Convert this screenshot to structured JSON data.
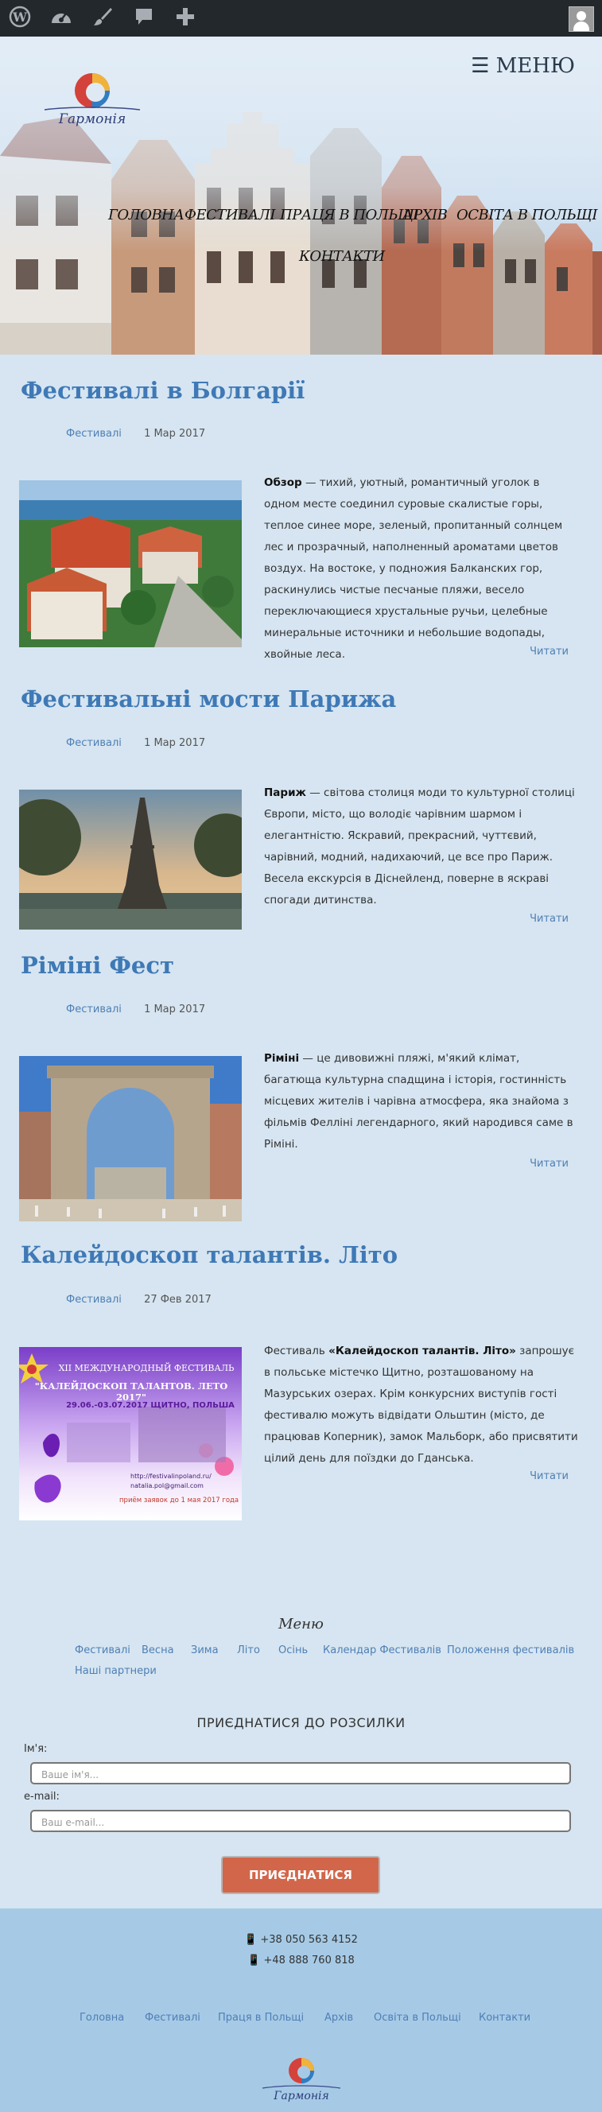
{
  "admin_bar": {
    "icons": [
      "wordpress-icon",
      "dashboard-icon",
      "customize-brush-icon",
      "comments-icon",
      "add-new-icon",
      "user-avatar-icon"
    ]
  },
  "header": {
    "logo_text": "Гармонія",
    "menu_toggle": "☰ МЕНЮ",
    "nav": [
      "ГОЛОВНА",
      "ФЕСТИВАЛІ",
      "ПРАЦЯ В ПОЛЬЩІ",
      "АРХІВ",
      "ОСВІТА В ПОЛЬЩІ",
      "КОНТАКТИ"
    ]
  },
  "posts": [
    {
      "title": "Фестивалі в Болгарії",
      "category": "Фестивалі",
      "date": "1 Мар 2017",
      "lead": "Обзор",
      "excerpt": " — тихий, уютный, романтичный уголок в одном месте соединил суровые скалистые горы, теплое синее море, зеленый, пропитанный солнцем лес и прозрачный, наполненный ароматами цветов воздух. На востоке, у подножия Балканских гор, раскинулись чистые песчаные пляжи, весело переключающиеся хрустальные ручьи, целебные минеральные источники и небольшие водопады, хвойные леса.",
      "more": "Читати"
    },
    {
      "title": "Фестивальні мости Парижа",
      "category": "Фестивалі",
      "date": "1 Мар 2017",
      "lead": "Париж",
      "excerpt": " — світова столиця моди то культурної столиці Європи, місто, що володіє чарівним шармом і елегантністю. Яскравий, прекрасний, чуттєвий, чарівний, модний, надихаючий, це все про Париж. Весела екскурсія в Діснейленд, поверне в яскраві спогади дитинства.",
      "more": "Читати"
    },
    {
      "title": "Ріміні Фест",
      "category": "Фестивалі",
      "date": "1 Мар 2017",
      "lead": "Ріміні",
      "excerpt": " — це дивовижні пляжі, м'який клімат, багатюща культурна спадщина і історія, гостинність місцевих жителів і чарівна атмосфера, яка знайома з фільмів Фелліні легендарного, який народився саме в Ріміні.",
      "more": "Читати"
    },
    {
      "title": "Калейдоскоп талантів. Літо",
      "category": "Фестивалі",
      "date": "27 Фев 2017",
      "lead_prefix": "Фестиваль ",
      "lead": "«Калейдоскоп талантів. Літо»",
      "excerpt": " запрошує в польське містечко Щитно, розташованому на Мазурських озерах. Крім конкурсних виступів гості фестивалю можуть відвідати Ольштин (місто, де працював Коперник), замок Мальборк, або присвятити цілий день для поїздки до Гданська.",
      "more": "Читати",
      "poster": {
        "line1": "XII МЕЖДУНАРОДНЫЙ ФЕСТИВАЛЬ",
        "line2": "\"КАЛЕЙДОСКОП ТАЛАНТОВ. ЛЕТО 2017\"",
        "dates": "29.06.-03.07.2017 ЩИТНО, ПОЛЬША",
        "site": "http://festivalinpoland.ru/",
        "email": "natalia.pol@gmail.com",
        "deadline": "приём заявок до 1 мая 2017 года"
      }
    }
  ],
  "footer_menu": {
    "title": "Меню",
    "items": [
      "Фестивалі",
      "Весна",
      "Зима",
      "Літо",
      "Осінь",
      "Календар Фестивалів",
      "Положення фестивалів",
      "Наші партнери"
    ]
  },
  "subscribe": {
    "title": "ПРИЄДНАТИСЯ ДО РОЗСИЛКИ",
    "name_label": "Ім'я:",
    "name_placeholder": "Ваше ім'я...",
    "email_label": "e-mail:",
    "email_placeholder": "Ваш e-mail...",
    "button": "ПРИЄДНАТИСЯ"
  },
  "footer": {
    "phones": [
      "+38 050 563 4152",
      "+48 888 760 818"
    ],
    "nav": [
      "Головна",
      "Фестивалі",
      "Праця в Польщі",
      "Архів",
      "Освіта в Польщі",
      "Контакти"
    ],
    "logo_text": "Гармонія"
  },
  "colors": {
    "background": "#d6e5f1",
    "link": "#4f7fb5",
    "title": "#3f79b6",
    "button": "#d2664a",
    "footer": "#a6cae6",
    "admin_bar": "#23282d"
  }
}
